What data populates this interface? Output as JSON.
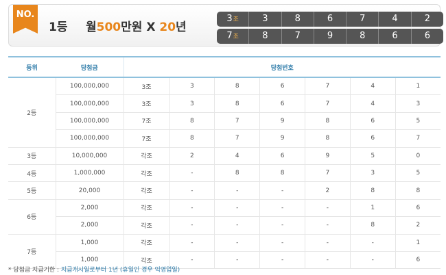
{
  "header": {
    "badge": "NO.",
    "rank": "1등",
    "prize_prefix": "월",
    "prize_amount": "500",
    "prize_suffix": "만원",
    "prize_x": "X",
    "prize_years": "20",
    "prize_years_suffix": "년",
    "numbers": [
      {
        "group": "3",
        "group_unit": "조",
        "digits": [
          "3",
          "8",
          "6",
          "7",
          "4",
          "2"
        ]
      },
      {
        "group": "7",
        "group_unit": "조",
        "digits": [
          "8",
          "7",
          "9",
          "8",
          "6",
          "6"
        ]
      }
    ]
  },
  "table": {
    "headers": {
      "rank": "등위",
      "amount": "당첨금",
      "numbers": "당첨번호"
    },
    "groups": [
      {
        "rank": "2등",
        "rows": [
          {
            "amount": "100,000,000",
            "group": "3조",
            "digits": [
              "3",
              "8",
              "6",
              "7",
              "4",
              "1"
            ]
          },
          {
            "amount": "100,000,000",
            "group": "3조",
            "digits": [
              "3",
              "8",
              "6",
              "7",
              "4",
              "3"
            ]
          },
          {
            "amount": "100,000,000",
            "group": "7조",
            "digits": [
              "8",
              "7",
              "9",
              "8",
              "6",
              "5"
            ]
          },
          {
            "amount": "100,000,000",
            "group": "7조",
            "digits": [
              "8",
              "7",
              "9",
              "8",
              "6",
              "7"
            ]
          }
        ]
      },
      {
        "rank": "3등",
        "rows": [
          {
            "amount": "10,000,000",
            "group": "각조",
            "digits": [
              "2",
              "4",
              "6",
              "9",
              "5",
              "0"
            ]
          }
        ]
      },
      {
        "rank": "4등",
        "rows": [
          {
            "amount": "1,000,000",
            "group": "각조",
            "digits": [
              "-",
              "8",
              "8",
              "7",
              "3",
              "5"
            ]
          }
        ]
      },
      {
        "rank": "5등",
        "rows": [
          {
            "amount": "20,000",
            "group": "각조",
            "digits": [
              "-",
              "-",
              "-",
              "2",
              "8",
              "8"
            ]
          }
        ]
      },
      {
        "rank": "6등",
        "rows": [
          {
            "amount": "2,000",
            "group": "각조",
            "digits": [
              "-",
              "-",
              "-",
              "-",
              "1",
              "6"
            ]
          },
          {
            "amount": "2,000",
            "group": "각조",
            "digits": [
              "-",
              "-",
              "-",
              "-",
              "8",
              "2"
            ]
          }
        ]
      },
      {
        "rank": "7등",
        "rows": [
          {
            "amount": "1,000",
            "group": "각조",
            "digits": [
              "-",
              "-",
              "-",
              "-",
              "-",
              "1"
            ]
          },
          {
            "amount": "1,000",
            "group": "각조",
            "digits": [
              "-",
              "-",
              "-",
              "-",
              "-",
              "6"
            ]
          }
        ]
      }
    ]
  },
  "footnote": {
    "label": "* 당첨금 지급기한 :",
    "text": "지급개시일로부터 1년 (휴일인 경우 익영업일)"
  }
}
